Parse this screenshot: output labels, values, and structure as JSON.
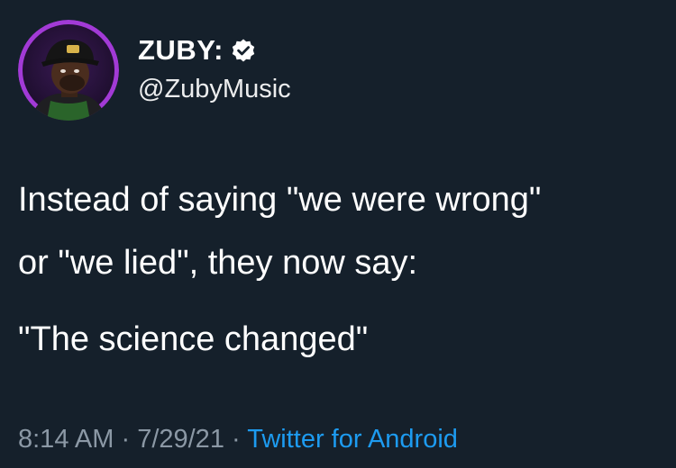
{
  "author": {
    "display_name": "ZUBY:",
    "handle": "@ZubyMusic",
    "verified": true
  },
  "tweet": {
    "lines": [
      "Instead of saying \"we were wrong\"",
      "or \"we lied\", they now say:",
      "\"The science changed\""
    ]
  },
  "meta": {
    "time": "8:14 AM",
    "sep1": " · ",
    "date": "7/29/21",
    "sep2": " · ",
    "source": "Twitter for Android"
  },
  "colors": {
    "background": "#15202b",
    "text": "#ffffff",
    "muted": "#8b98a5",
    "link": "#1d9bf0",
    "avatar_ring": "#9b30d0"
  },
  "icons": {
    "verified": "verified-badge-icon",
    "avatar": "profile-avatar"
  }
}
